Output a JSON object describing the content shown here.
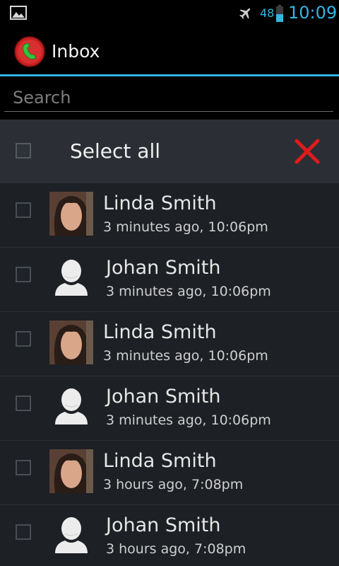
{
  "status_bar": {
    "battery_percent": "48",
    "battery_level": 0.48,
    "time": "10:09",
    "icons": [
      "picture-icon",
      "airplane-icon",
      "battery-icon"
    ],
    "accent_color": "#33b5e5"
  },
  "action_bar": {
    "title": "Inbox",
    "app_icon": "call-recorder-icon"
  },
  "search": {
    "placeholder": "Search",
    "value": ""
  },
  "select_all": {
    "label": "Select all",
    "checked": false,
    "delete_icon": "close-icon",
    "delete_color": "#e01b1b"
  },
  "calls": [
    {
      "name": "Linda Smith",
      "time": "3 minutes ago, 10:06pm",
      "avatar": "photo",
      "checked": false
    },
    {
      "name": "Johan Smith",
      "time": "3 minutes ago, 10:06pm",
      "avatar": "generic",
      "checked": false
    },
    {
      "name": "Linda Smith",
      "time": "3 minutes ago, 10:06pm",
      "avatar": "photo",
      "checked": false
    },
    {
      "name": "Johan Smith",
      "time": "3 minutes ago, 10:06pm",
      "avatar": "generic",
      "checked": false
    },
    {
      "name": "Linda Smith",
      "time": "3 hours ago, 7:08pm",
      "avatar": "photo",
      "checked": false
    },
    {
      "name": "Johan Smith",
      "time": "3 hours ago, 7:08pm",
      "avatar": "generic",
      "checked": false
    }
  ]
}
